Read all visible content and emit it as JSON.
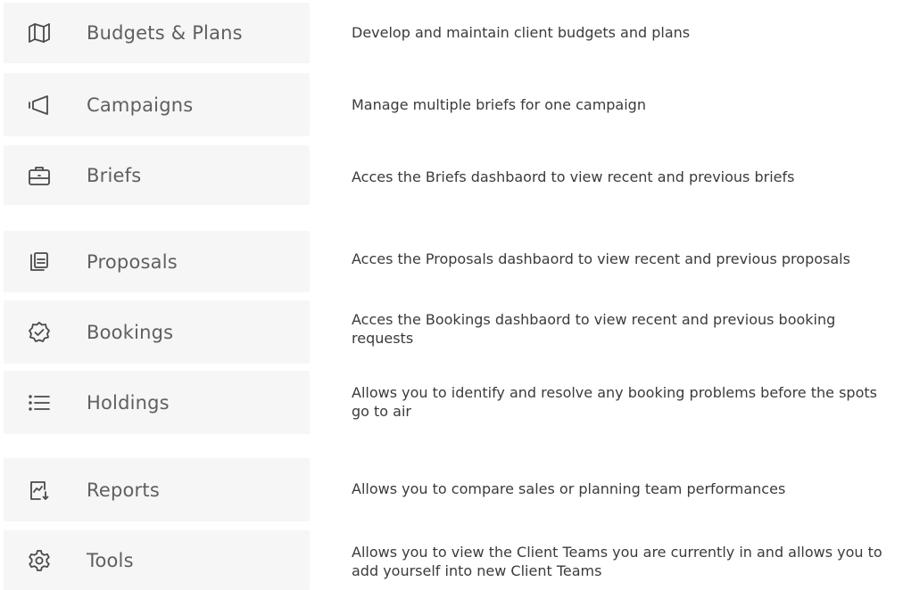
{
  "menu": {
    "items": [
      {
        "label": "Budgets & Plans",
        "icon": "map-icon",
        "description": "Develop and maintain client budgets and plans"
      },
      {
        "label": "Campaigns",
        "icon": "megaphone-icon",
        "description": "Manage multiple briefs for one campaign"
      },
      {
        "label": "Briefs",
        "icon": "briefcase-icon",
        "description": "Acces the Briefs dashbaord to view recent and previous briefs"
      },
      {
        "label": "Proposals",
        "icon": "documents-icon",
        "description": "Acces the Proposals dashbaord to view recent and previous proposals"
      },
      {
        "label": "Bookings",
        "icon": "badge-check-icon",
        "description": "Acces the Bookings dashbaord to view recent and previous booking requests"
      },
      {
        "label": "Holdings",
        "icon": "list-icon",
        "description": "Allows you to identify and resolve any booking problems before the spots go to air"
      },
      {
        "label": "Reports",
        "icon": "report-icon",
        "description": "Allows you to compare sales or planning team performances"
      },
      {
        "label": "Tools",
        "icon": "gear-icon",
        "description": "Allows you to view the Client Teams you are currently in and allows you to add yourself into new Client Teams"
      }
    ]
  },
  "colors": {
    "card_background": "#f6f6f6",
    "label_text": "#5f5f5f",
    "description_text": "#3b3b3b",
    "icon_stroke": "#4a4a4a"
  }
}
